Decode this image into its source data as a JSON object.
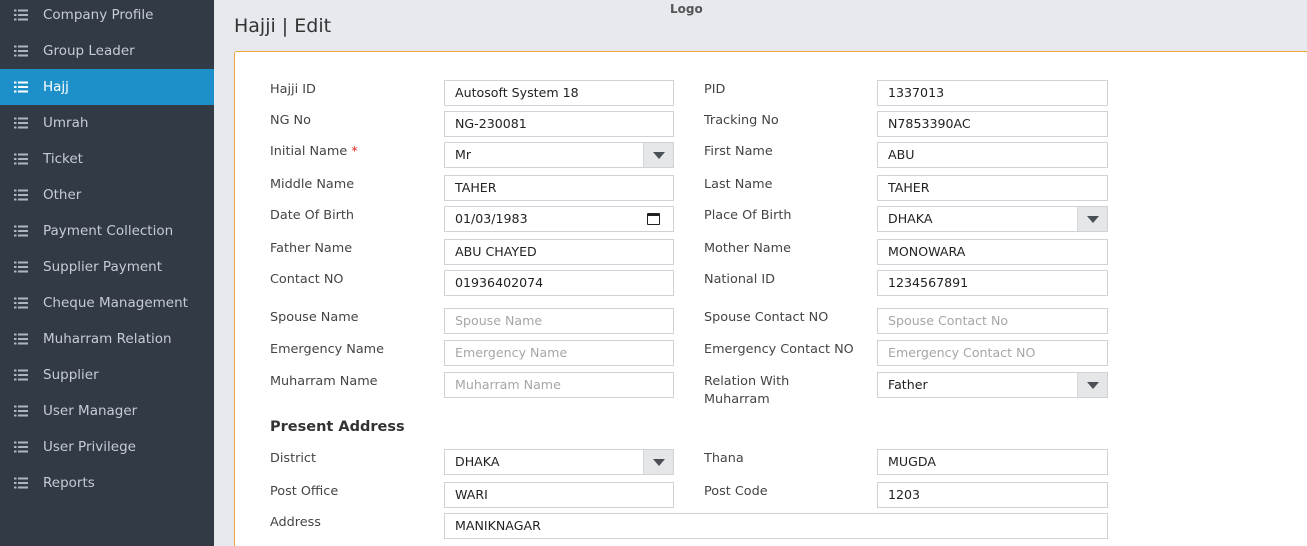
{
  "header": {
    "logo": "Logo",
    "page_title": "Hajji | Edit"
  },
  "sidebar": {
    "items": [
      {
        "label": "Company Profile"
      },
      {
        "label": "Group Leader"
      },
      {
        "label": "Hajj",
        "active": true
      },
      {
        "label": "Umrah"
      },
      {
        "label": "Ticket"
      },
      {
        "label": "Other"
      },
      {
        "label": "Payment Collection"
      },
      {
        "label": "Supplier Payment"
      },
      {
        "label": "Cheque Management"
      },
      {
        "label": "Muharram Relation"
      },
      {
        "label": "Supplier"
      },
      {
        "label": "User Manager"
      },
      {
        "label": "User Privilege"
      },
      {
        "label": "Reports"
      }
    ]
  },
  "form": {
    "hajji_id": {
      "label": "Hajji ID",
      "value": "Autosoft System 18"
    },
    "pid": {
      "label": "PID",
      "value": "1337013"
    },
    "ng_no": {
      "label": "NG No",
      "value": "NG-230081"
    },
    "tracking_no": {
      "label": "Tracking No",
      "value": "N7853390AC"
    },
    "initial_name": {
      "label": "Initial Name",
      "required_mark": "*",
      "value": "Mr"
    },
    "first_name": {
      "label": "First Name",
      "value": "ABU"
    },
    "middle_name": {
      "label": "Middle Name",
      "value": "TAHER"
    },
    "last_name": {
      "label": "Last Name",
      "value": "TAHER"
    },
    "date_of_birth": {
      "label": "Date Of Birth",
      "value": "01/03/1983"
    },
    "place_of_birth": {
      "label": "Place Of Birth",
      "value": "DHAKA"
    },
    "father_name": {
      "label": "Father Name",
      "value": "ABU CHAYED"
    },
    "mother_name": {
      "label": "Mother Name",
      "value": "MONOWARA"
    },
    "contact_no": {
      "label": "Contact NO",
      "value": "01936402074"
    },
    "national_id": {
      "label": "National ID",
      "value": "1234567891"
    },
    "spouse_name": {
      "label": "Spouse Name",
      "placeholder": "Spouse Name"
    },
    "spouse_contact_no": {
      "label": "Spouse Contact NO",
      "placeholder": "Spouse Contact No"
    },
    "emergency_name": {
      "label": "Emergency Name",
      "placeholder": "Emergency Name"
    },
    "emergency_contact_no": {
      "label": "Emergency Contact NO",
      "placeholder": "Emergency Contact NO"
    },
    "muharram_name": {
      "label": "Muharram Name",
      "placeholder": "Muharram Name"
    },
    "relation_with_muharram": {
      "label_line1": "Relation With",
      "label_line2": "Muharram",
      "value": "Father"
    },
    "present_address_title": "Present Address",
    "district": {
      "label": "District",
      "value": "DHAKA"
    },
    "thana": {
      "label": "Thana",
      "value": "MUGDA"
    },
    "post_office": {
      "label": "Post Office",
      "value": "WARI"
    },
    "post_code": {
      "label": "Post Code",
      "value": "1203"
    },
    "address": {
      "label": "Address",
      "value": "MANIKNAGAR"
    }
  }
}
